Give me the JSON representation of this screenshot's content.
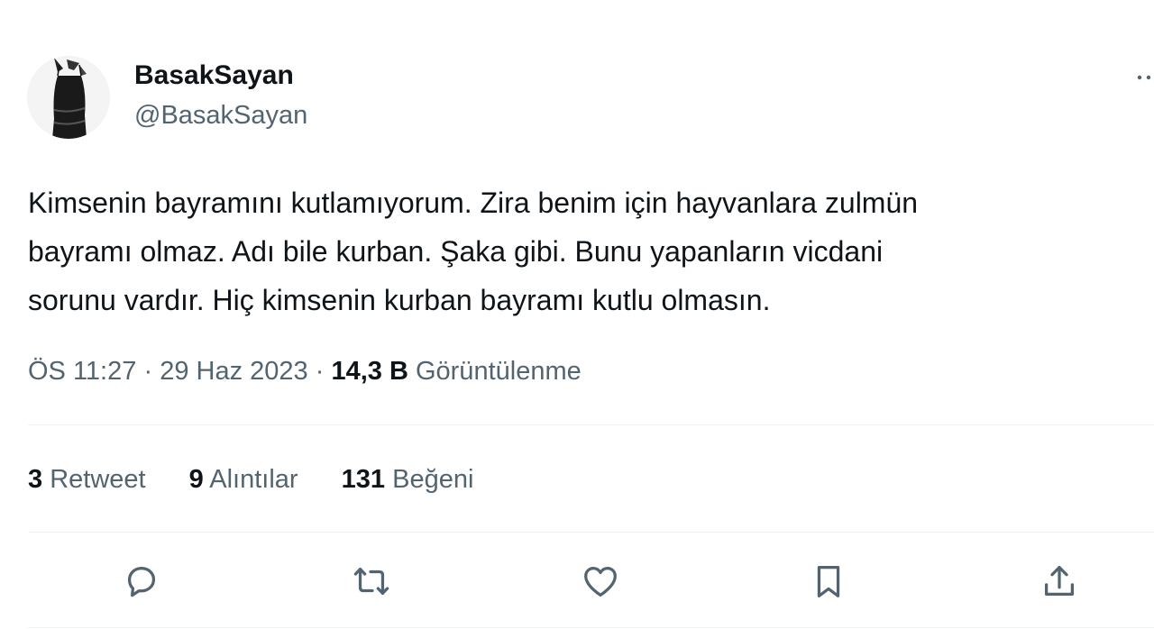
{
  "author": {
    "display_name": "BasakSayan",
    "handle": "@BasakSayan"
  },
  "tweet": {
    "lines": [
      "Kimsenin bayramını kutlamıyorum. Zira benim için hayvanlara zulmün",
      "bayramı olmaz. Adı bile kurban. Şaka gibi. Bunu yapanların vicdani",
      "sorunu vardır. Hiç kimsenin kurban bayramı kutlu olmasın."
    ]
  },
  "meta": {
    "time": "ÖS 11:27",
    "separator": "·",
    "date": "29 Haz 2023",
    "views_count": "14,3 B",
    "views_label": "Görüntülenme"
  },
  "stats": {
    "retweets": {
      "count": "3",
      "label": "Retweet"
    },
    "quotes": {
      "count": "9",
      "label": "Alıntılar"
    },
    "likes": {
      "count": "131",
      "label": "Beğeni"
    }
  },
  "actions": [
    "reply-icon",
    "retweet-icon",
    "like-icon",
    "bookmark-icon",
    "share-icon"
  ],
  "colors": {
    "text": "#0f1419",
    "secondary": "#536471",
    "divider": "#eff3f4"
  }
}
